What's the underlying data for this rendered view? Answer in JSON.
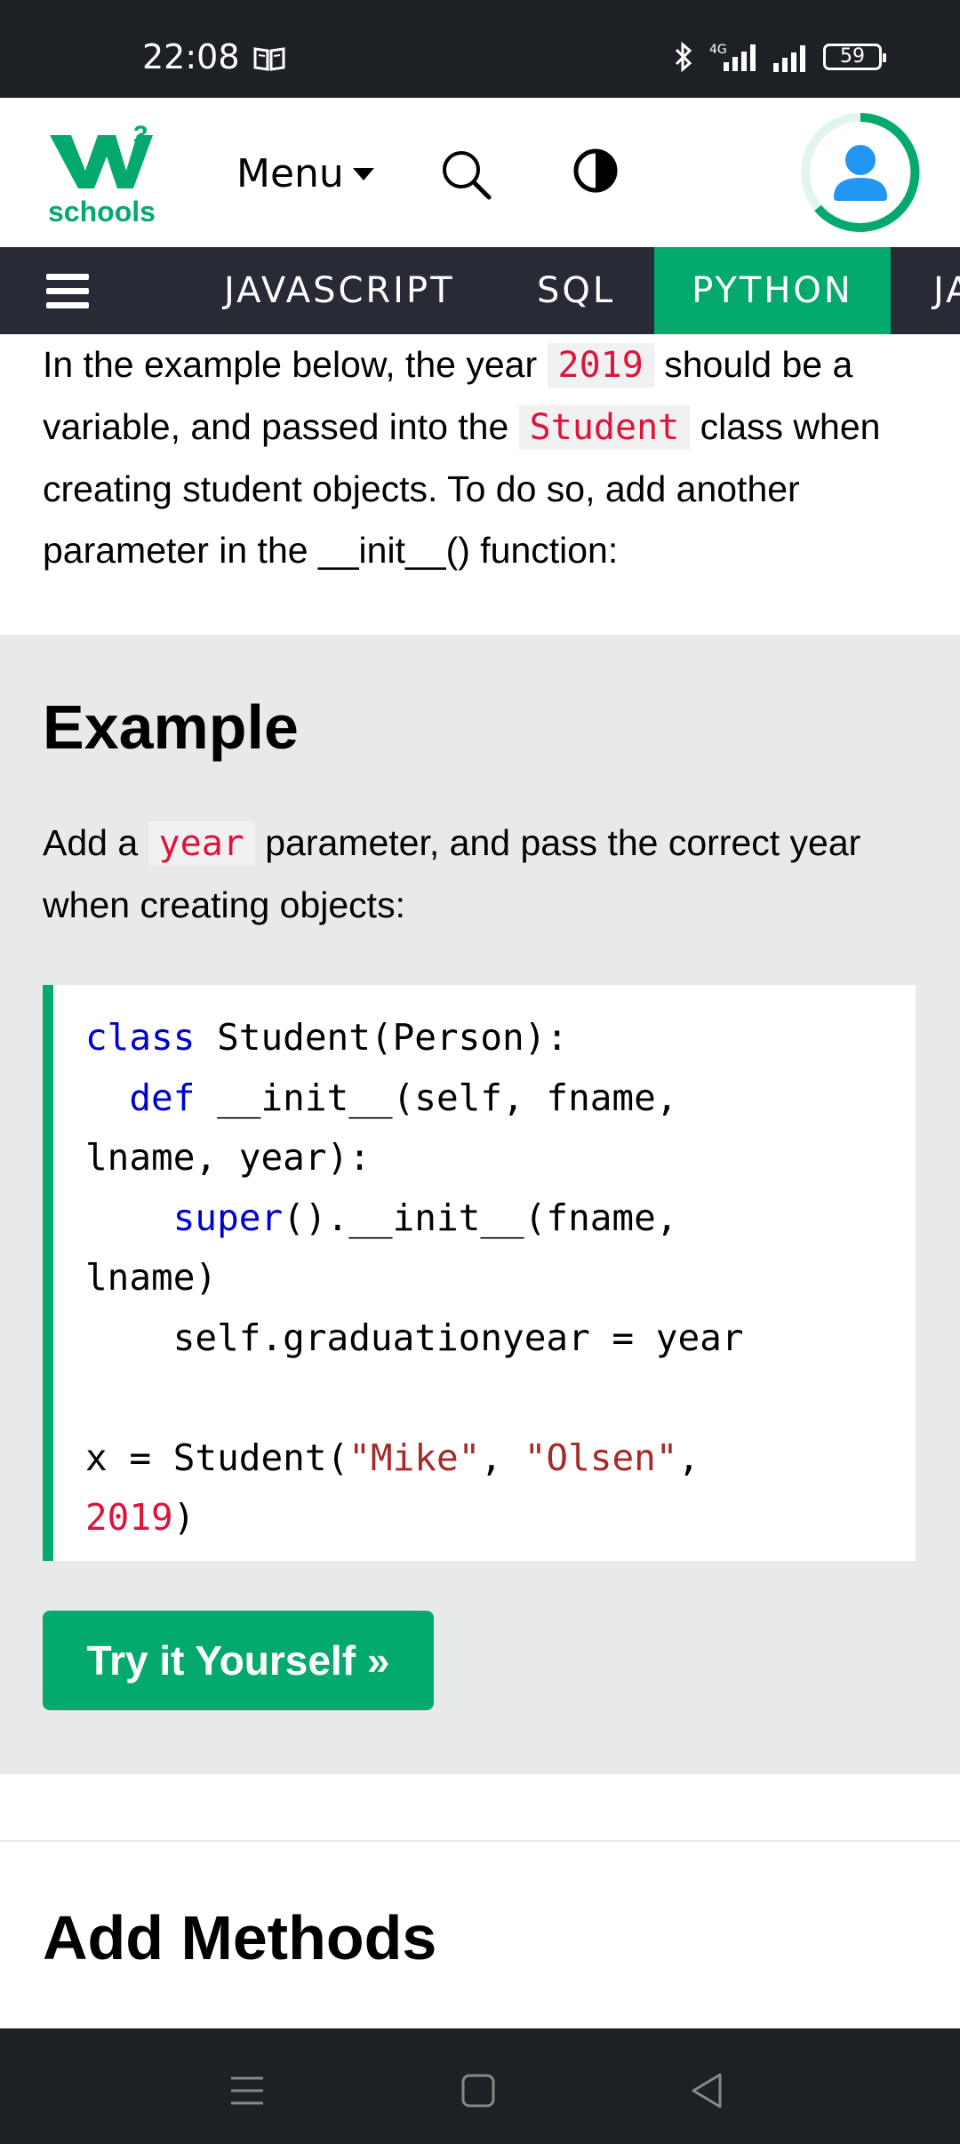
{
  "status_bar": {
    "time": "22:08",
    "battery": "59",
    "network": "4G"
  },
  "header": {
    "logo_superscript": "3",
    "logo_text": "schools",
    "menu_label": "Menu",
    "brand_color": "#04aa6d"
  },
  "navbar": {
    "items": [
      "JAVASCRIPT",
      "SQL",
      "PYTHON",
      "JA"
    ],
    "active": "PYTHON"
  },
  "intro": {
    "t1": "In the example below, the year ",
    "c1": "2019",
    "t2": " should be a variable, and passed into the ",
    "c2": "Student",
    "t3": " class when creating student objects. To do so, add another parameter in the __init__() function:"
  },
  "example": {
    "title": "Example",
    "desc_pre": "Add a ",
    "desc_code": "year",
    "desc_post": " parameter, and pass the correct year when creating objects:",
    "code": {
      "l1_kw": "class",
      "l1_rest": " Student(Person):",
      "l2_kw": "def",
      "l2_rest": " __init__(self, fname,",
      "l3": "lname, year):",
      "l4_kw": "super",
      "l4_rest": "().__init__(fname,",
      "l5": "lname)",
      "l6": "self.graduationyear = year",
      "l8_a": "x = Student(",
      "l8_s1": "\"Mike\"",
      "l8_b": ", ",
      "l8_s2": "\"Olsen\"",
      "l8_c": ",",
      "l9_num": "2019",
      "l9_rest": ")"
    },
    "try_button": "Try it Yourself »"
  },
  "next_section": {
    "title": "Add Methods"
  }
}
